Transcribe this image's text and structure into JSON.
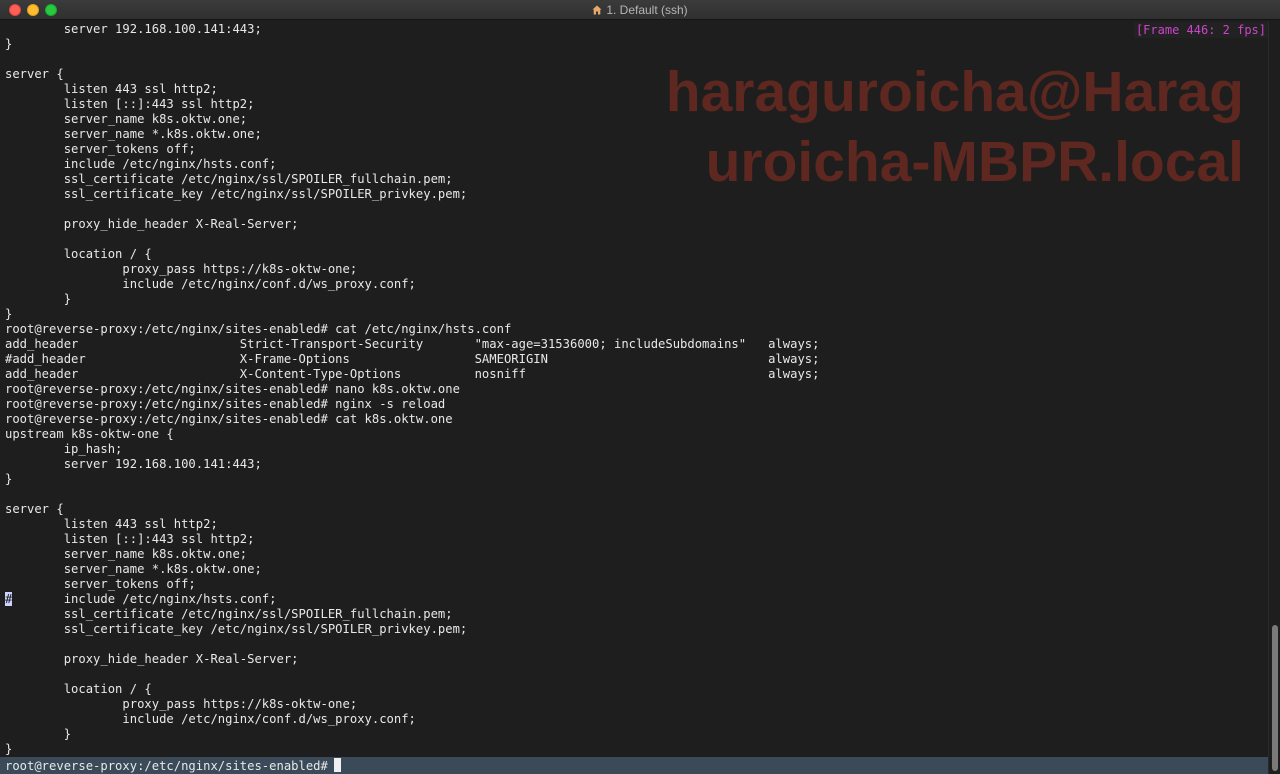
{
  "window": {
    "title": "1. Default (ssh)",
    "title_icon": "home-icon"
  },
  "frame_badge": "[Frame 446: 2 fps]",
  "watermark": {
    "line1": "haraguroicha@Harag",
    "line2": "uroicha-MBPR.local"
  },
  "terminal_lines": [
    "        server 192.168.100.141:443;",
    "}",
    "",
    "server {",
    "        listen 443 ssl http2;",
    "        listen [::]:443 ssl http2;",
    "        server_name k8s.oktw.one;",
    "        server_name *.k8s.oktw.one;",
    "        server_tokens off;",
    "        include /etc/nginx/hsts.conf;",
    "        ssl_certificate /etc/nginx/ssl/SPOILER_fullchain.pem;",
    "        ssl_certificate_key /etc/nginx/ssl/SPOILER_privkey.pem;",
    "",
    "        proxy_hide_header X-Real-Server;",
    "",
    "        location / {",
    "                proxy_pass https://k8s-oktw-one;",
    "                include /etc/nginx/conf.d/ws_proxy.conf;",
    "        }",
    "}",
    "root@reverse-proxy:/etc/nginx/sites-enabled# cat /etc/nginx/hsts.conf",
    "add_header                      Strict-Transport-Security       \"max-age=31536000; includeSubdomains\"   always;",
    "#add_header                     X-Frame-Options                 SAMEORIGIN                              always;",
    "add_header                      X-Content-Type-Options          nosniff                                 always;",
    "root@reverse-proxy:/etc/nginx/sites-enabled# nano k8s.oktw.one",
    "root@reverse-proxy:/etc/nginx/sites-enabled# nginx -s reload",
    "root@reverse-proxy:/etc/nginx/sites-enabled# cat k8s.oktw.one",
    "upstream k8s-oktw-one {",
    "        ip_hash;",
    "        server 192.168.100.141:443;",
    "}",
    "",
    "server {",
    "        listen 443 ssl http2;",
    "        listen [::]:443 ssl http2;",
    "        server_name k8s.oktw.one;",
    "        server_name *.k8s.oktw.one;",
    "        server_tokens off;",
    "",
    "        ssl_certificate /etc/nginx/ssl/SPOILER_fullchain.pem;",
    "        ssl_certificate_key /etc/nginx/ssl/SPOILER_privkey.pem;",
    "",
    "        proxy_hide_header X-Real-Server;",
    "",
    "        location / {",
    "                proxy_pass https://k8s-oktw-one;",
    "                include /etc/nginx/conf.d/ws_proxy.conf;",
    "        }",
    "}"
  ],
  "marked_line": {
    "mark": "#",
    "rest": "       include /etc/nginx/hsts.conf;"
  },
  "prompt": "root@reverse-proxy:/etc/nginx/sites-enabled#",
  "colors": {
    "watermark": "#642820",
    "frame_badge": "#cc44cc",
    "prompt_bar": "#3a4a58"
  }
}
